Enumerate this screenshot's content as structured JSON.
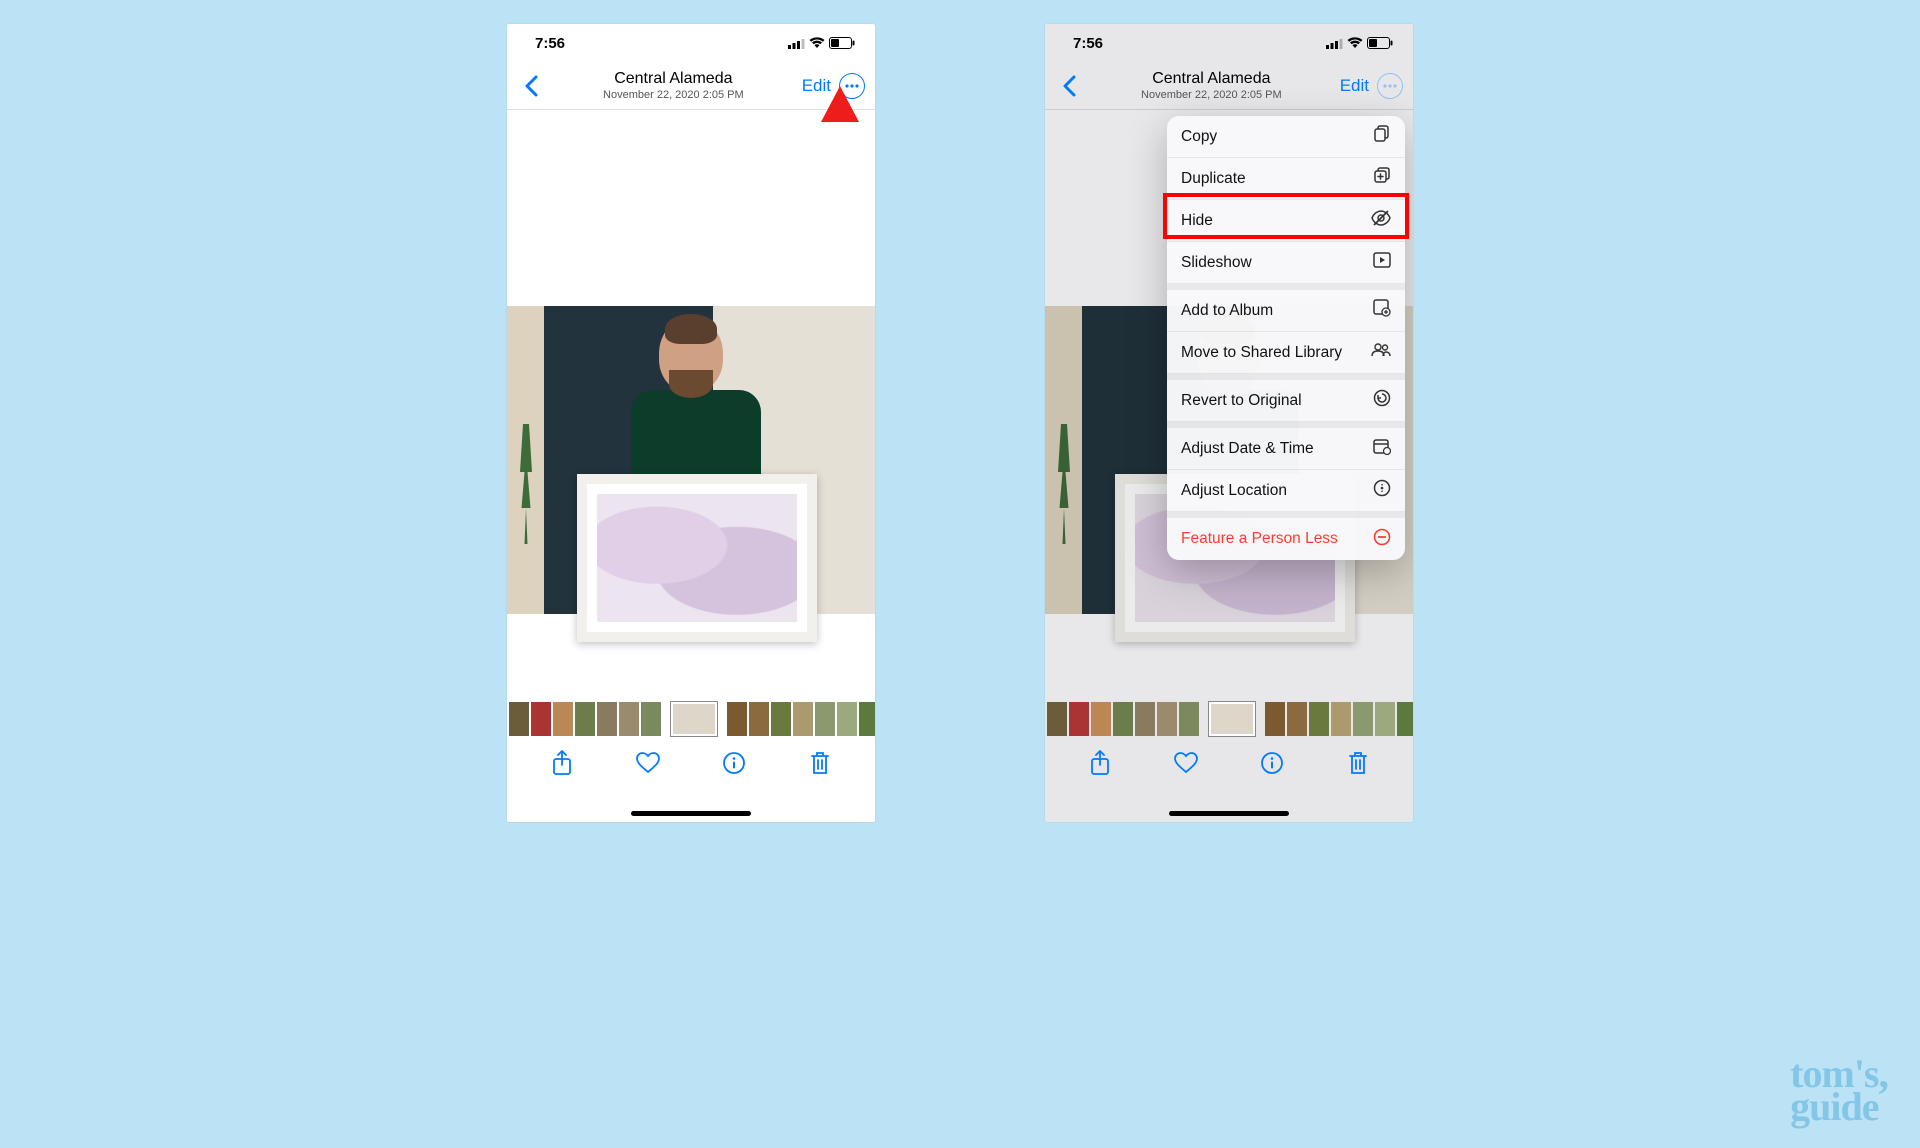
{
  "status": {
    "time": "7:56"
  },
  "nav": {
    "location": "Central Alameda",
    "timestamp": "November 22, 2020  2:05 PM",
    "edit": "Edit"
  },
  "menu": {
    "items": [
      {
        "label": "Copy",
        "icon": "copy"
      },
      {
        "label": "Duplicate",
        "icon": "duplicate"
      },
      {
        "label": "Hide",
        "icon": "hide",
        "highlight": true
      },
      {
        "label": "Slideshow",
        "icon": "play"
      }
    ],
    "group2": [
      {
        "label": "Add to Album",
        "icon": "album"
      },
      {
        "label": "Move to Shared Library",
        "icon": "people"
      }
    ],
    "group3": [
      {
        "label": "Revert to Original",
        "icon": "revert"
      }
    ],
    "group4": [
      {
        "label": "Adjust Date & Time",
        "icon": "calendar"
      },
      {
        "label": "Adjust Location",
        "icon": "location"
      }
    ],
    "group5": [
      {
        "label": "Feature a Person Less",
        "icon": "minus",
        "red": true
      }
    ]
  },
  "watermark": {
    "line1": "tom's",
    "line2": "guide"
  }
}
